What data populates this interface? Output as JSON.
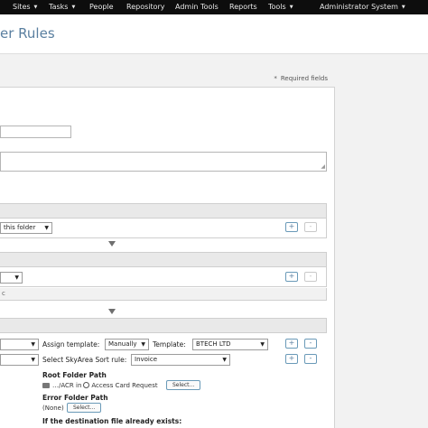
{
  "nav": {
    "sites": "Sites",
    "tasks": "Tasks",
    "people": "People",
    "repository": "Repository",
    "admin_tools": "Admin Tools",
    "reports": "Reports",
    "tools": "Tools",
    "user": "Administrator System",
    "caret": "▼"
  },
  "page": {
    "title": "er Rules",
    "required_star": "*",
    "required_text": "Required fields"
  },
  "form": {
    "section1_select": "this folder",
    "section2_select": "",
    "light_bar_text": "c",
    "rule": {
      "first_select": "",
      "assign_template_label": "Assign template:",
      "assign_template_value": "Manually",
      "template_label": "Template:",
      "template_value": "BTECH LTD",
      "second_select": "",
      "sort_rule_label": "Select SkyArea Sort rule:",
      "sort_rule_value": "Invoice",
      "root_folder_label": "Root Folder Path",
      "root_path_prefix": "…/ACR in",
      "root_path_name": "Access Card Request",
      "select_label": "Select...",
      "error_folder_label": "Error Folder Path",
      "error_path_value": "(None)",
      "exists_label": "If the destination file already exists:"
    },
    "add_symbol": "+",
    "remove_symbol": "-",
    "dropdown_arrow": "▼"
  },
  "icons": {
    "folder": "folder-icon",
    "globe": "globe-icon",
    "expand": "triangle-down-icon",
    "resize": "resize-grip-icon"
  },
  "colors": {
    "topbar": "#0d0d0d",
    "accent": "#5a7fa0"
  }
}
